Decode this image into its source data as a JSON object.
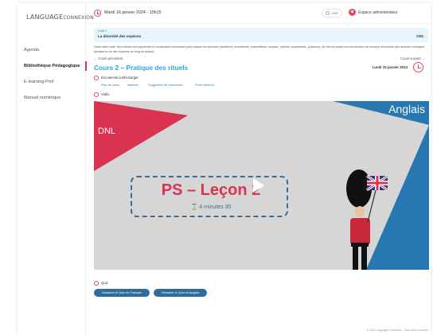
{
  "logo": {
    "line1": "LANGUAGE",
    "line2": "CONNEXION"
  },
  "sidebar": {
    "items": [
      {
        "label": "Agenda",
        "active": false
      },
      {
        "label": "Bibliothèque Pédagogique",
        "active": true
      },
      {
        "label": "E-learning Prof",
        "active": false
      },
      {
        "label": "Manuel numérique",
        "active": false
      }
    ]
  },
  "topbar": {
    "date": "Mardi 16 janvier 2024 - 10h15",
    "help_label": "Aide",
    "user_label": "Espace administrateur"
  },
  "course": {
    "small_label": "Unité 2",
    "title": "La diversité des espèces",
    "cycle": "CM1",
    "intro": "Dans cette unité, les enfants vont apprendre le vocabulaire nécessaire pour classer les animaux (vertébrés, invertébrés, mammifères, oiseaux, reptiles, amphibiens, poissons). Ils verront aussi une introduction au concept d'évolution (les animaux changent pendant la vie des espèces au long du temps)."
  },
  "navigation": {
    "prev_label": "← Cours précédent",
    "next_label": "Cours suivant →"
  },
  "lesson": {
    "title": "Cours 2 – Pratique des rituels",
    "date": "Lundi 15 janvier 2024"
  },
  "documents": {
    "label": "Documents à télécharger",
    "links": [
      "Plan de cours",
      "Matériel",
      "Suggestion de ressources",
      "Fiche élève/ex"
    ]
  },
  "video": {
    "label": "Vidéo",
    "dnl": "DNL",
    "anglais": "Anglais",
    "title": "PS – Leçon 2",
    "duration": "⌛ 4 minutes 30"
  },
  "quiz": {
    "label": "Quiz",
    "buttons": [
      "Démarrer le Quiz en Français",
      "Démarrer le Quiz en Anglais"
    ]
  },
  "footer": "© 2024 Language Connexion - Tous droits réservés",
  "colors": {
    "accent": "#d9334f",
    "blue": "#2aa5de",
    "button": "#2f6c9b"
  }
}
